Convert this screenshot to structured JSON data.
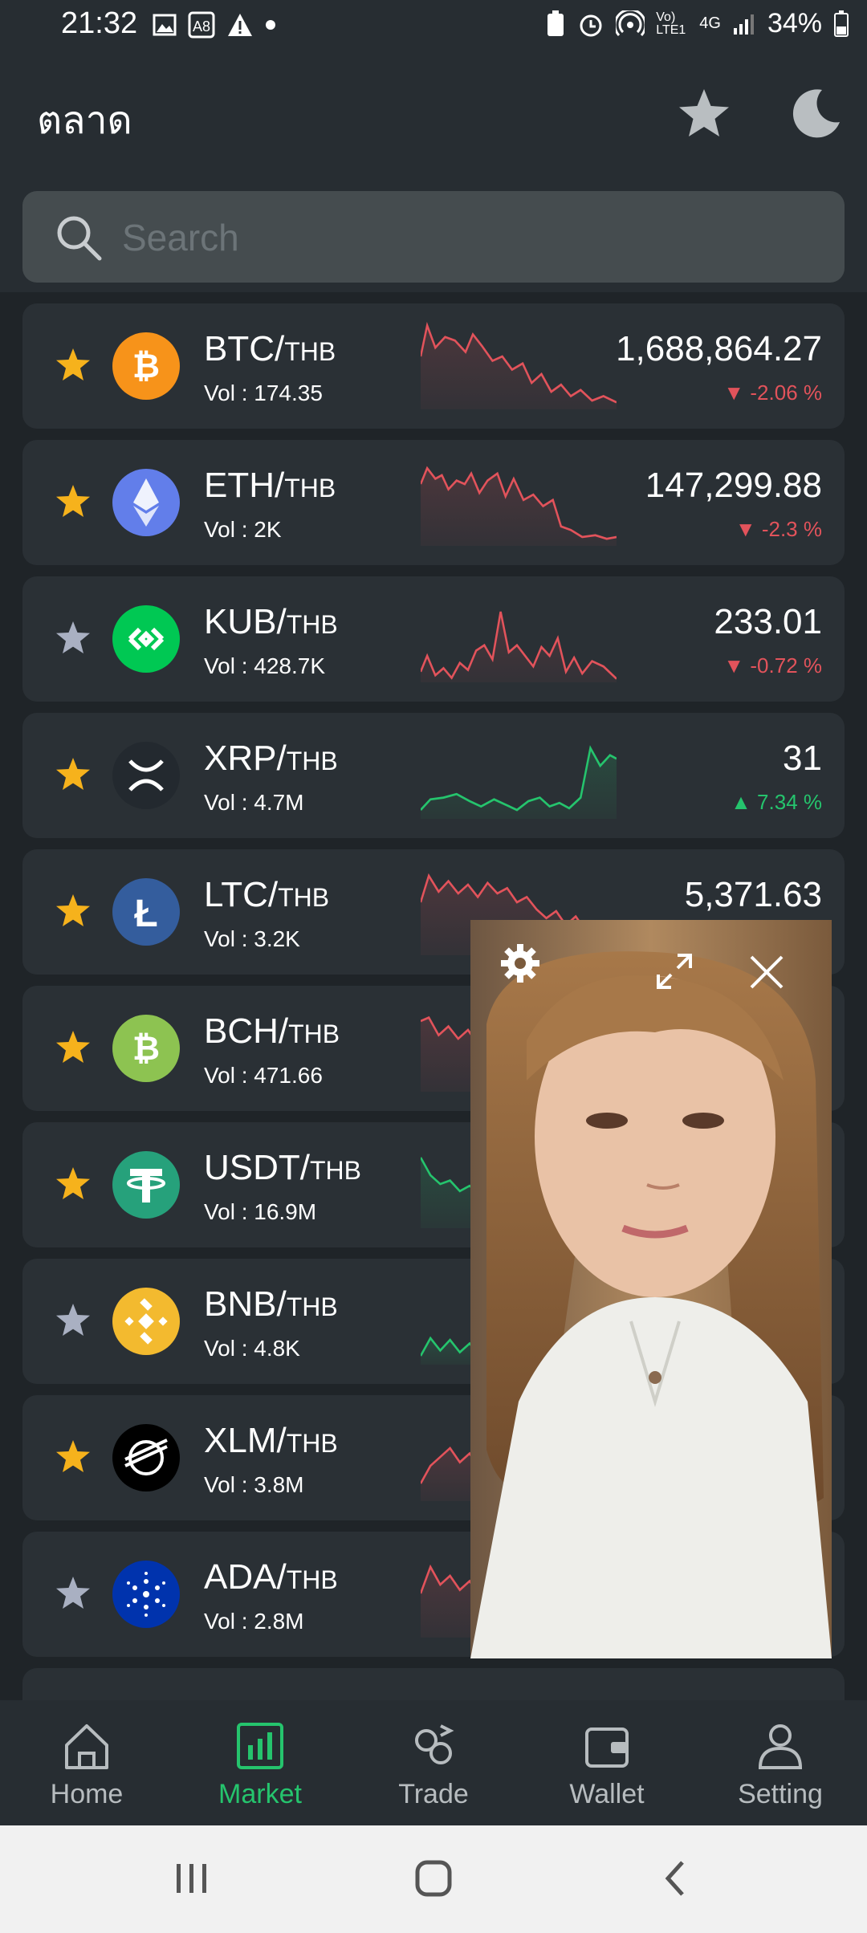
{
  "status": {
    "time": "21:32",
    "battery": "34%",
    "network": "4G",
    "volte": "Vo) LTE1"
  },
  "header": {
    "title": "ตลาด",
    "star_icon": "star-icon",
    "theme_icon": "moon-icon"
  },
  "search": {
    "placeholder": "Search"
  },
  "colors": {
    "up": "#25c46d",
    "down": "#e2535b",
    "fav": "#f6b21c",
    "nonfav": "#a9b0c2",
    "card": "#2a3035",
    "accent": "#25c46d"
  },
  "coins": [
    {
      "base": "BTC/",
      "quote": "THB",
      "vol": "Vol : 174.35",
      "price": "1,688,864.27",
      "change": "-2.06 %",
      "direction": "down",
      "favorite": true,
      "logo": "bitcoin-logo"
    },
    {
      "base": "ETH/",
      "quote": "THB",
      "vol": "Vol : 2K",
      "price": "147,299.88",
      "change": "-2.3 %",
      "direction": "down",
      "favorite": true,
      "logo": "ethereum-logo"
    },
    {
      "base": "KUB/",
      "quote": "THB",
      "vol": "Vol : 428.7K",
      "price": "233.01",
      "change": "-0.72 %",
      "direction": "down",
      "favorite": false,
      "logo": "kub-logo"
    },
    {
      "base": "XRP/",
      "quote": "THB",
      "vol": "Vol : 4.7M",
      "price": "31",
      "change": "7.34 %",
      "direction": "up",
      "favorite": true,
      "logo": "xrp-logo"
    },
    {
      "base": "LTC/",
      "quote": "THB",
      "vol": "Vol : 3.2K",
      "price": "5,371.63",
      "change": "",
      "direction": "down",
      "favorite": true,
      "logo": "litecoin-logo"
    },
    {
      "base": "BCH/",
      "quote": "THB",
      "vol": "Vol : 471.66",
      "price": "",
      "change": "",
      "direction": "down",
      "favorite": true,
      "logo": "bitcoin-cash-logo"
    },
    {
      "base": "USDT/",
      "quote": "THB",
      "vol": "Vol : 16.9M",
      "price": "",
      "change": "",
      "direction": "up",
      "favorite": true,
      "logo": "tether-logo"
    },
    {
      "base": "BNB/",
      "quote": "THB",
      "vol": "Vol : 4.8K",
      "price": "",
      "change": "",
      "direction": "up",
      "favorite": false,
      "logo": "bnb-logo"
    },
    {
      "base": "XLM/",
      "quote": "THB",
      "vol": "Vol : 3.8M",
      "price": "",
      "change": "",
      "direction": "down",
      "favorite": true,
      "logo": "stellar-logo"
    },
    {
      "base": "ADA/",
      "quote": "THB",
      "vol": "Vol : 2.8M",
      "price": "",
      "change": "",
      "direction": "down",
      "favorite": false,
      "logo": "cardano-logo"
    }
  ],
  "pip": {
    "settings_icon": "gear-icon",
    "expand_icon": "expand-icon",
    "close_icon": "close-icon"
  },
  "nav": [
    {
      "label": "Home",
      "icon": "home-icon",
      "active": false
    },
    {
      "label": "Market",
      "icon": "market-chart-icon",
      "active": true
    },
    {
      "label": "Trade",
      "icon": "trade-icon",
      "active": false
    },
    {
      "label": "Wallet",
      "icon": "wallet-icon",
      "active": false
    },
    {
      "label": "Setting",
      "icon": "user-icon",
      "active": false
    }
  ]
}
